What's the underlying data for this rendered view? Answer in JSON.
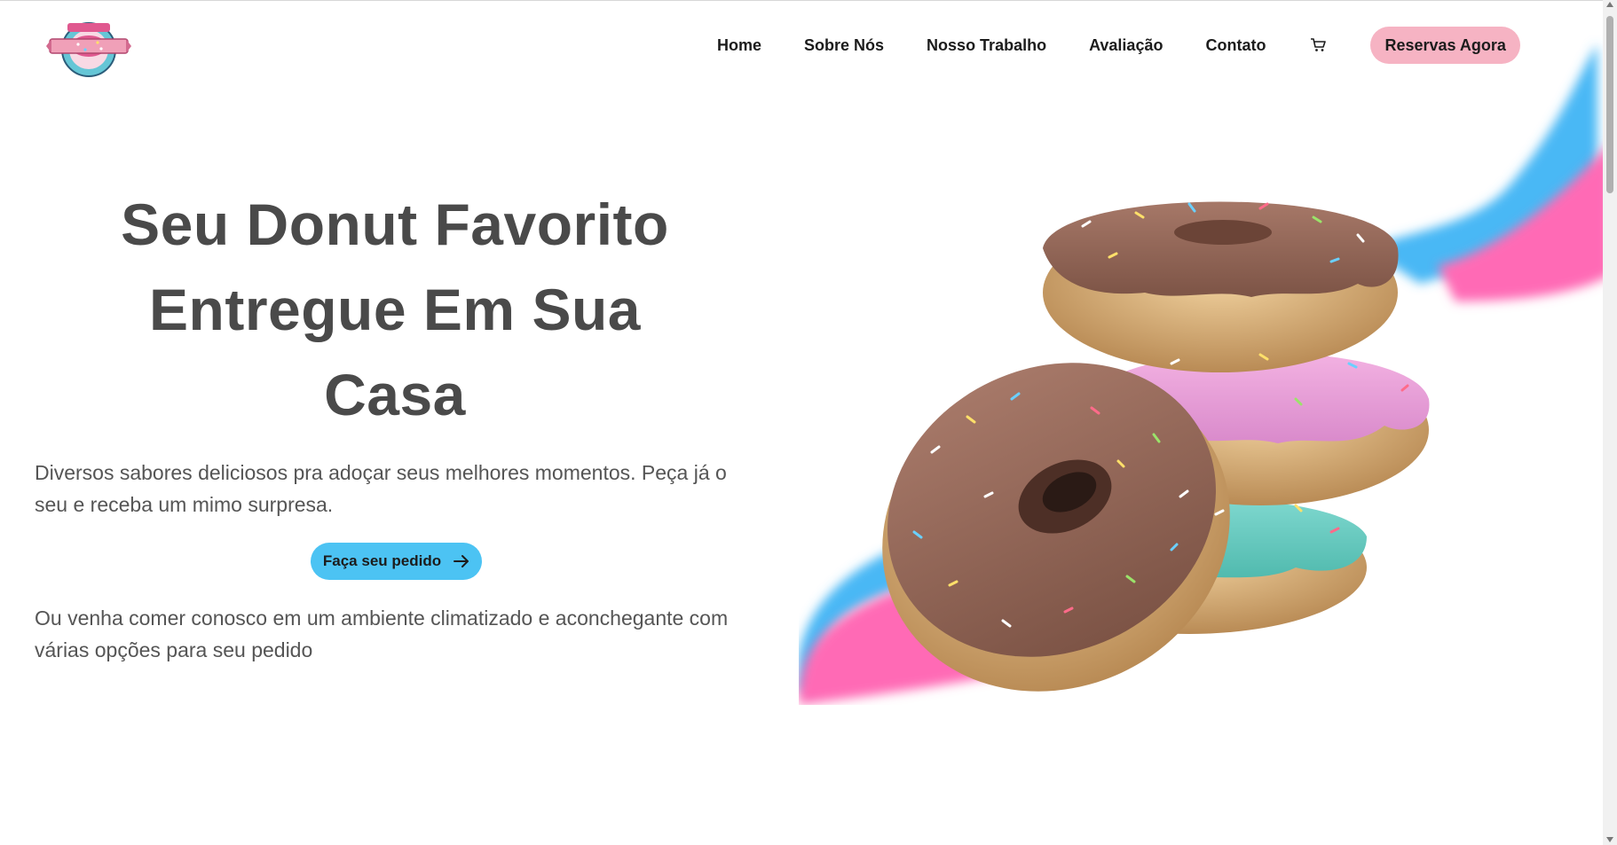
{
  "header": {
    "logo_alt": "Donut shop logo",
    "nav": [
      {
        "label": "Home"
      },
      {
        "label": "Sobre Nós"
      },
      {
        "label": "Nosso Trabalho"
      },
      {
        "label": "Avaliação"
      },
      {
        "label": "Contato"
      }
    ],
    "cart_icon": "cart-icon",
    "reserve_label": "Reservas Agora"
  },
  "hero": {
    "title_line1": "Seu Donut Favorito",
    "title_line2": "Entregue Em Sua",
    "title_line3": "Casa",
    "description": "Diversos sabores deliciosos pra adoçar seus melhores momentos. Peça já o seu e receba um mimo surpresa.",
    "order_label": "Faça seu pedido",
    "order_icon": "arrow-right-icon",
    "subtext": "Ou venha comer conosco em um ambiente climatizado e aconchegante com várias opções para seu pedido"
  },
  "colors": {
    "accent_blue": "#4cc3f3",
    "accent_pink": "#f6b3c3",
    "splash_pink": "#ff6bb5",
    "splash_blue": "#4ab8f5",
    "text_dark": "#4a4a4a"
  }
}
